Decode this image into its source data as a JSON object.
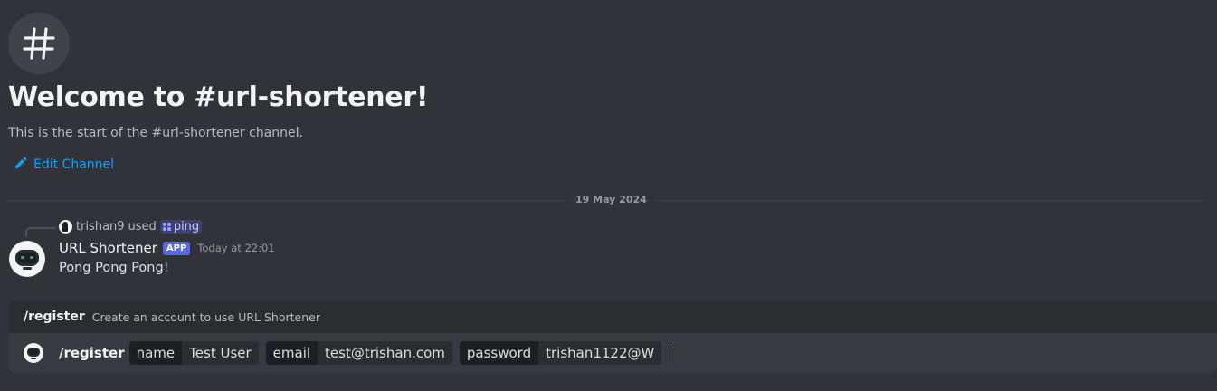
{
  "header": {
    "icon": "hashtag-icon",
    "title": "Welcome to #url-shortener!",
    "subtitle": "This is the start of the #url-shortener channel.",
    "edit_label": "Edit Channel"
  },
  "divider": {
    "date": "19 May 2024"
  },
  "message": {
    "reply_user": "trishan9",
    "reply_used": "used",
    "reply_command": "ping",
    "author": "URL Shortener",
    "badge": "APP",
    "timestamp": "Today at 22:01",
    "content": "Pong Pong Pong!"
  },
  "command_bar": {
    "hint_name": "/register",
    "hint_description": "Create an account to use URL Shortener",
    "prefix": "/register",
    "options": [
      {
        "name": "name",
        "value": "Test User"
      },
      {
        "name": "email",
        "value": "test@trishan.com"
      },
      {
        "name": "password",
        "value": "trishan1122@W"
      }
    ]
  },
  "colors": {
    "background": "#313338",
    "link": "#00a8fc",
    "badge": "#5865f2"
  }
}
